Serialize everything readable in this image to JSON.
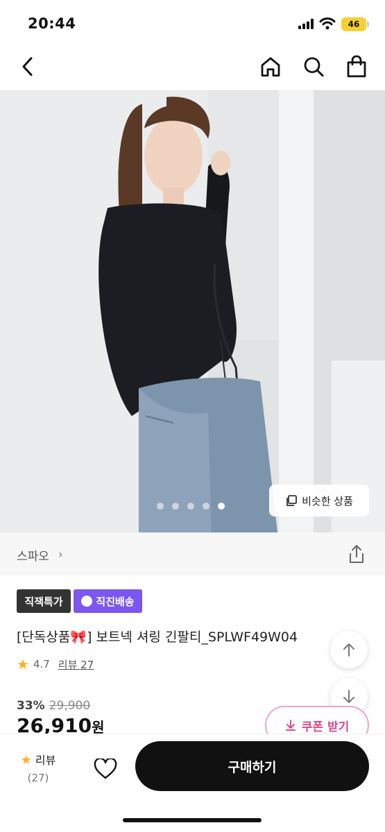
{
  "status_bar": {
    "time": "20:44",
    "battery": "46"
  },
  "nav": {
    "icons": [
      "back-arrow-icon",
      "home-icon",
      "search-icon",
      "shopping-bag-icon"
    ]
  },
  "gallery": {
    "total_images": 5,
    "active_index": 4,
    "similar_button_label": "비슷한 상품"
  },
  "brand": {
    "name": "스파오",
    "chevron": "›"
  },
  "badges": {
    "direct_label": "직잭특가",
    "ship_label": "직진배송"
  },
  "colors": {
    "ship_badge": "#7b56f0",
    "coupon_accent": "#e0468d",
    "star": "#ffb01f"
  },
  "product": {
    "title_prefix": "[단독상품",
    "title_suffix": "] 보트넥 셔링 긴팔티_SPLWF49W04",
    "rating": "4.7",
    "review_link": "리뷰 27"
  },
  "price": {
    "discount_rate": "33%",
    "original": "29,900",
    "sale": "26,910",
    "unit": "원"
  },
  "coupon": {
    "label": "쿠폰 받기"
  },
  "bottom_bar": {
    "review_label": "리뷰",
    "review_count": "(27)",
    "buy_label": "구매하기"
  }
}
